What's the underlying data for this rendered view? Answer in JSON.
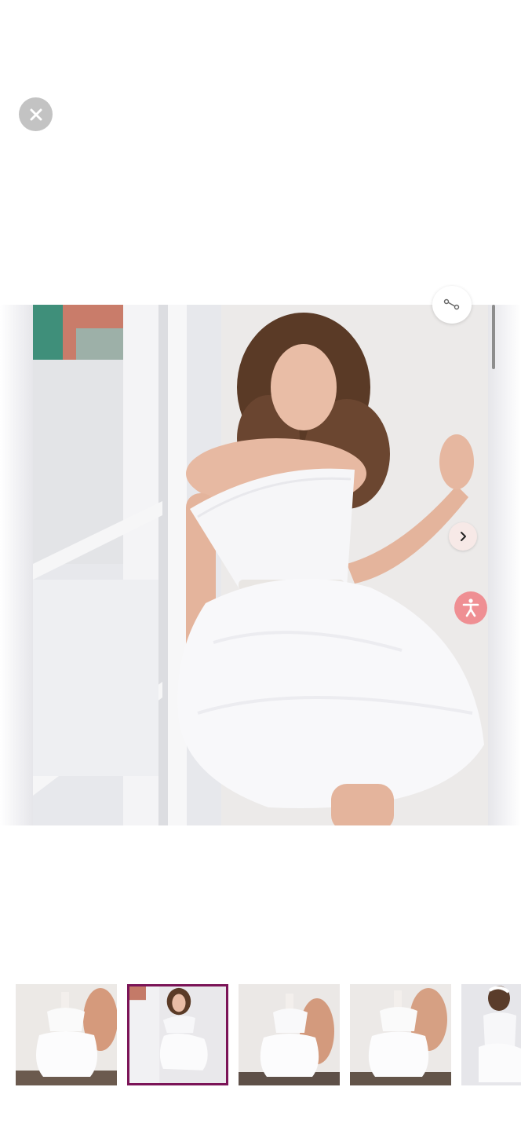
{
  "viewer": {
    "close_icon": "close-icon",
    "share_icon": "share-icon",
    "next_icon": "chevron-right-icon",
    "accessibility_icon": "accessibility-icon",
    "accent_color": "#7b1457",
    "accessibility_color": "#ef8f93"
  },
  "gallery": {
    "selected_index": 1,
    "thumbnail_count": 5
  }
}
